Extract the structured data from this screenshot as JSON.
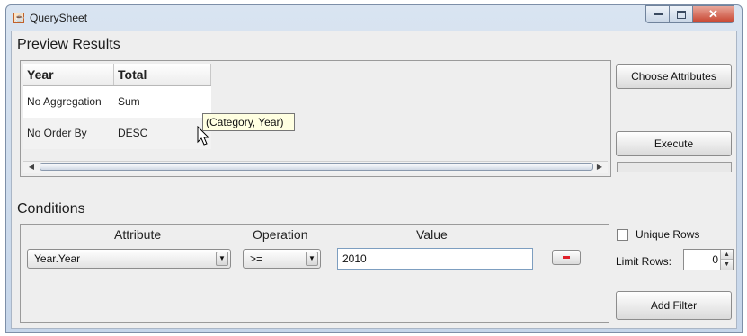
{
  "window": {
    "title": "QuerySheet",
    "app_icon": "java-icon"
  },
  "preview": {
    "section_title": "Preview Results",
    "columns": [
      "Year",
      "Total"
    ],
    "rows": [
      [
        "No Aggregation",
        "Sum"
      ],
      [
        "No Order By",
        "DESC"
      ]
    ],
    "tooltip": "(Category, Year)"
  },
  "buttons": {
    "choose_attributes": "Choose Attributes",
    "execute": "Execute",
    "add_filter": "Add Filter"
  },
  "conditions": {
    "section_title": "Conditions",
    "headers": {
      "attribute": "Attribute",
      "operation": "Operation",
      "value": "Value"
    },
    "filter": {
      "attribute": "Year.Year",
      "operation": ">=",
      "value": "2010"
    }
  },
  "options": {
    "unique_rows_label": "Unique Rows",
    "unique_rows_checked": false,
    "limit_rows_label": "Limit Rows:",
    "limit_rows_value": "0"
  }
}
